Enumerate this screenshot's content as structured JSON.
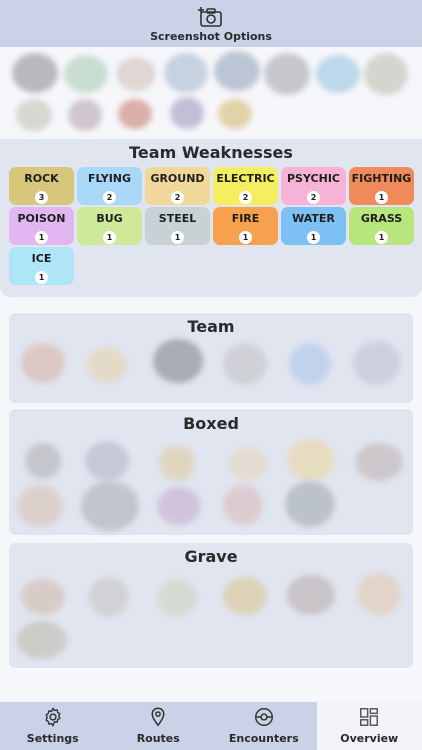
{
  "header": {
    "title": "Screenshot Options",
    "icon": "camera-add-icon"
  },
  "weaknesses": {
    "title": "Team Weaknesses",
    "types": [
      {
        "name": "ROCK",
        "count": "3",
        "color": "#d8c77a"
      },
      {
        "name": "FLYING",
        "count": "2",
        "color": "#a9d8f8"
      },
      {
        "name": "GROUND",
        "count": "2",
        "color": "#f0d89a"
      },
      {
        "name": "ELECTRIC",
        "count": "2",
        "color": "#f6ee61"
      },
      {
        "name": "PSYCHIC",
        "count": "2",
        "color": "#f7b2d8"
      },
      {
        "name": "FIGHTING",
        "count": "1",
        "color": "#f08a5a"
      },
      {
        "name": "POISON",
        "count": "1",
        "color": "#e2b6f0"
      },
      {
        "name": "BUG",
        "count": "1",
        "color": "#cfe99a"
      },
      {
        "name": "STEEL",
        "count": "1",
        "color": "#c8d2d4"
      },
      {
        "name": "FIRE",
        "count": "1",
        "color": "#f7a04e"
      },
      {
        "name": "WATER",
        "count": "1",
        "color": "#7cc0f4"
      },
      {
        "name": "GRASS",
        "count": "1",
        "color": "#b6e67c"
      },
      {
        "name": "ICE",
        "count": "1",
        "color": "#aee6f8"
      }
    ]
  },
  "sections": {
    "team": {
      "title": "Team"
    },
    "boxed": {
      "title": "Boxed"
    },
    "grave": {
      "title": "Grave"
    }
  },
  "tabs": [
    {
      "label": "Settings",
      "icon": "gear-icon",
      "active": false
    },
    {
      "label": "Routes",
      "icon": "map-pin-icon",
      "active": false
    },
    {
      "label": "Encounters",
      "icon": "pokeball-icon",
      "active": false
    },
    {
      "label": "Overview",
      "icon": "dashboard-icon",
      "active": true
    }
  ]
}
